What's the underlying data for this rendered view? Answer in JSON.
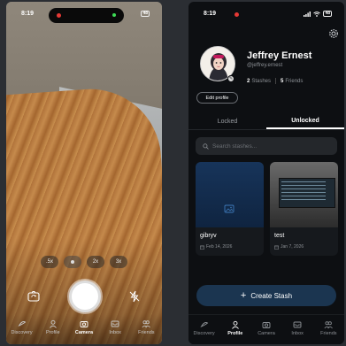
{
  "left_phone": {
    "status": {
      "time": "8:19",
      "battery": "48"
    },
    "zoom_options": [
      ".5x",
      "1x",
      "2x",
      "3x"
    ],
    "tabbar": [
      {
        "label": "Discovery",
        "icon": "discovery-icon",
        "active": false
      },
      {
        "label": "Profile",
        "icon": "profile-icon",
        "active": false
      },
      {
        "label": "Camera",
        "icon": "camera-icon",
        "active": true
      },
      {
        "label": "Inbox",
        "icon": "inbox-icon",
        "active": false
      },
      {
        "label": "Friends",
        "icon": "friends-icon",
        "active": false
      }
    ]
  },
  "right_phone": {
    "status": {
      "time": "8:19",
      "battery": "48"
    },
    "profile": {
      "name": "Jeffrey Ernest",
      "handle": "@jeffrey.ernest",
      "stashes_count": "2",
      "stashes_label": "Stashes",
      "friends_count": "5",
      "friends_label": "Friends",
      "edit_label": "Edit profile"
    },
    "segments": {
      "locked": "Locked",
      "unlocked": "Unlocked",
      "selected": "unlocked"
    },
    "search": {
      "placeholder": "Search stashes..."
    },
    "stashes": [
      {
        "title": "gibryv",
        "date": "Feb 14, 2026"
      },
      {
        "title": "test",
        "date": "Jan 7, 2026"
      }
    ],
    "create_label": "Create Stash",
    "tabbar": [
      {
        "label": "Discovery",
        "icon": "discovery-icon",
        "active": false
      },
      {
        "label": "Profile",
        "icon": "profile-icon",
        "active": true
      },
      {
        "label": "Camera",
        "icon": "camera-icon",
        "active": false
      },
      {
        "label": "Inbox",
        "icon": "inbox-icon",
        "active": false
      },
      {
        "label": "Friends",
        "icon": "friends-icon",
        "active": false
      }
    ]
  },
  "colors": {
    "accent_button": "#1b3550",
    "background_dark": "#0d0f12",
    "recording_red": "#e53935"
  }
}
